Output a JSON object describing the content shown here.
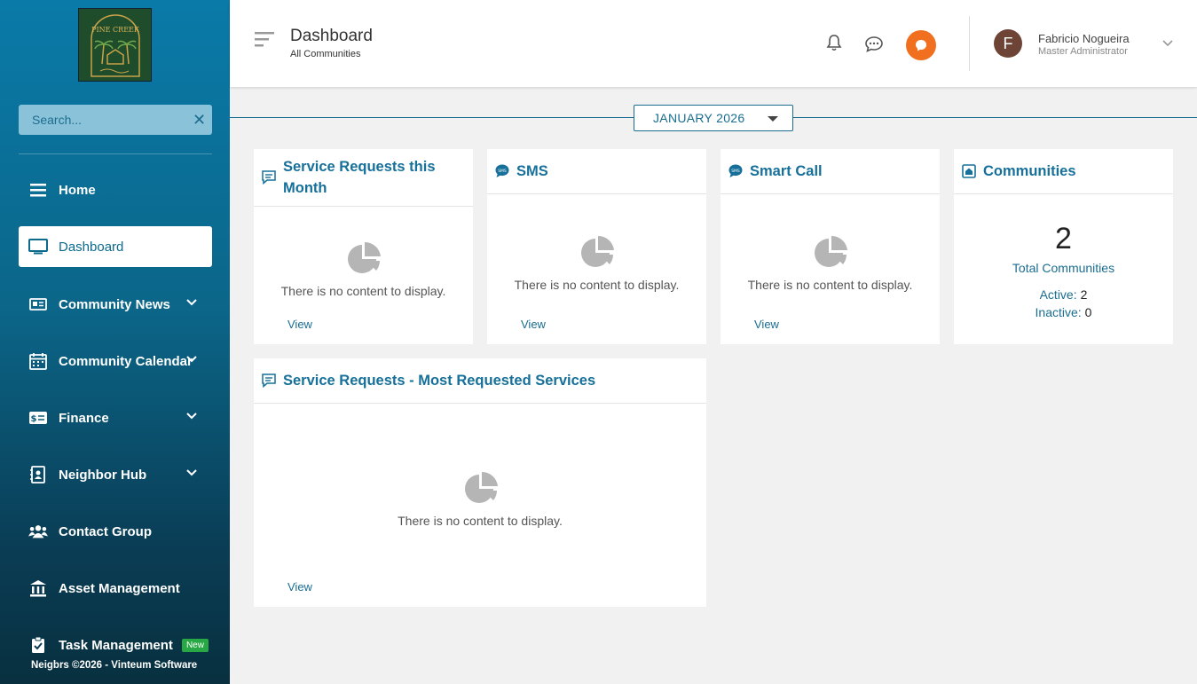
{
  "brand": {
    "logo_text": "PINE CREEK",
    "footer": "Neigbrs ©2026 - Vinteum Software"
  },
  "search": {
    "placeholder": "Search..."
  },
  "nav": {
    "home": "Home",
    "dashboard": "Dashboard",
    "community_news": "Community News",
    "community_calendar": "Community Calendar",
    "finance": "Finance",
    "neighbor_hub": "Neighbor Hub",
    "contact_group": "Contact Group",
    "asset_management": "Asset Management",
    "task_management": "Task Management",
    "task_badge": "New"
  },
  "header": {
    "title": "Dashboard",
    "subtitle": "All Communities",
    "user_initial": "F",
    "user_name": "Fabricio Nogueira",
    "user_role": "Master Administrator"
  },
  "month": {
    "selected": "JANUARY 2026"
  },
  "cards": {
    "service_requests": {
      "title": "Service Requests this Month",
      "empty": "There is no content to display.",
      "link": "View"
    },
    "sms": {
      "title": "SMS",
      "empty": "There is no content to display.",
      "link": "View"
    },
    "smart_call": {
      "title": "Smart Call",
      "empty": "There is no content to display.",
      "link": "View"
    },
    "communities": {
      "title": "Communities",
      "total": "2",
      "total_label": "Total Communities",
      "active_label": "Active:",
      "active_value": "2",
      "inactive_label": "Inactive:",
      "inactive_value": "0"
    },
    "most_requested": {
      "title": "Service Requests - Most Requested Services",
      "empty": "There is no content to display.",
      "link": "View"
    }
  },
  "colors": {
    "accent": "#16709a",
    "sidebar_top": "#0a7aa8",
    "sidebar_bottom": "#08303f",
    "notification_button": "#f07020",
    "new_badge": "#27a844"
  }
}
